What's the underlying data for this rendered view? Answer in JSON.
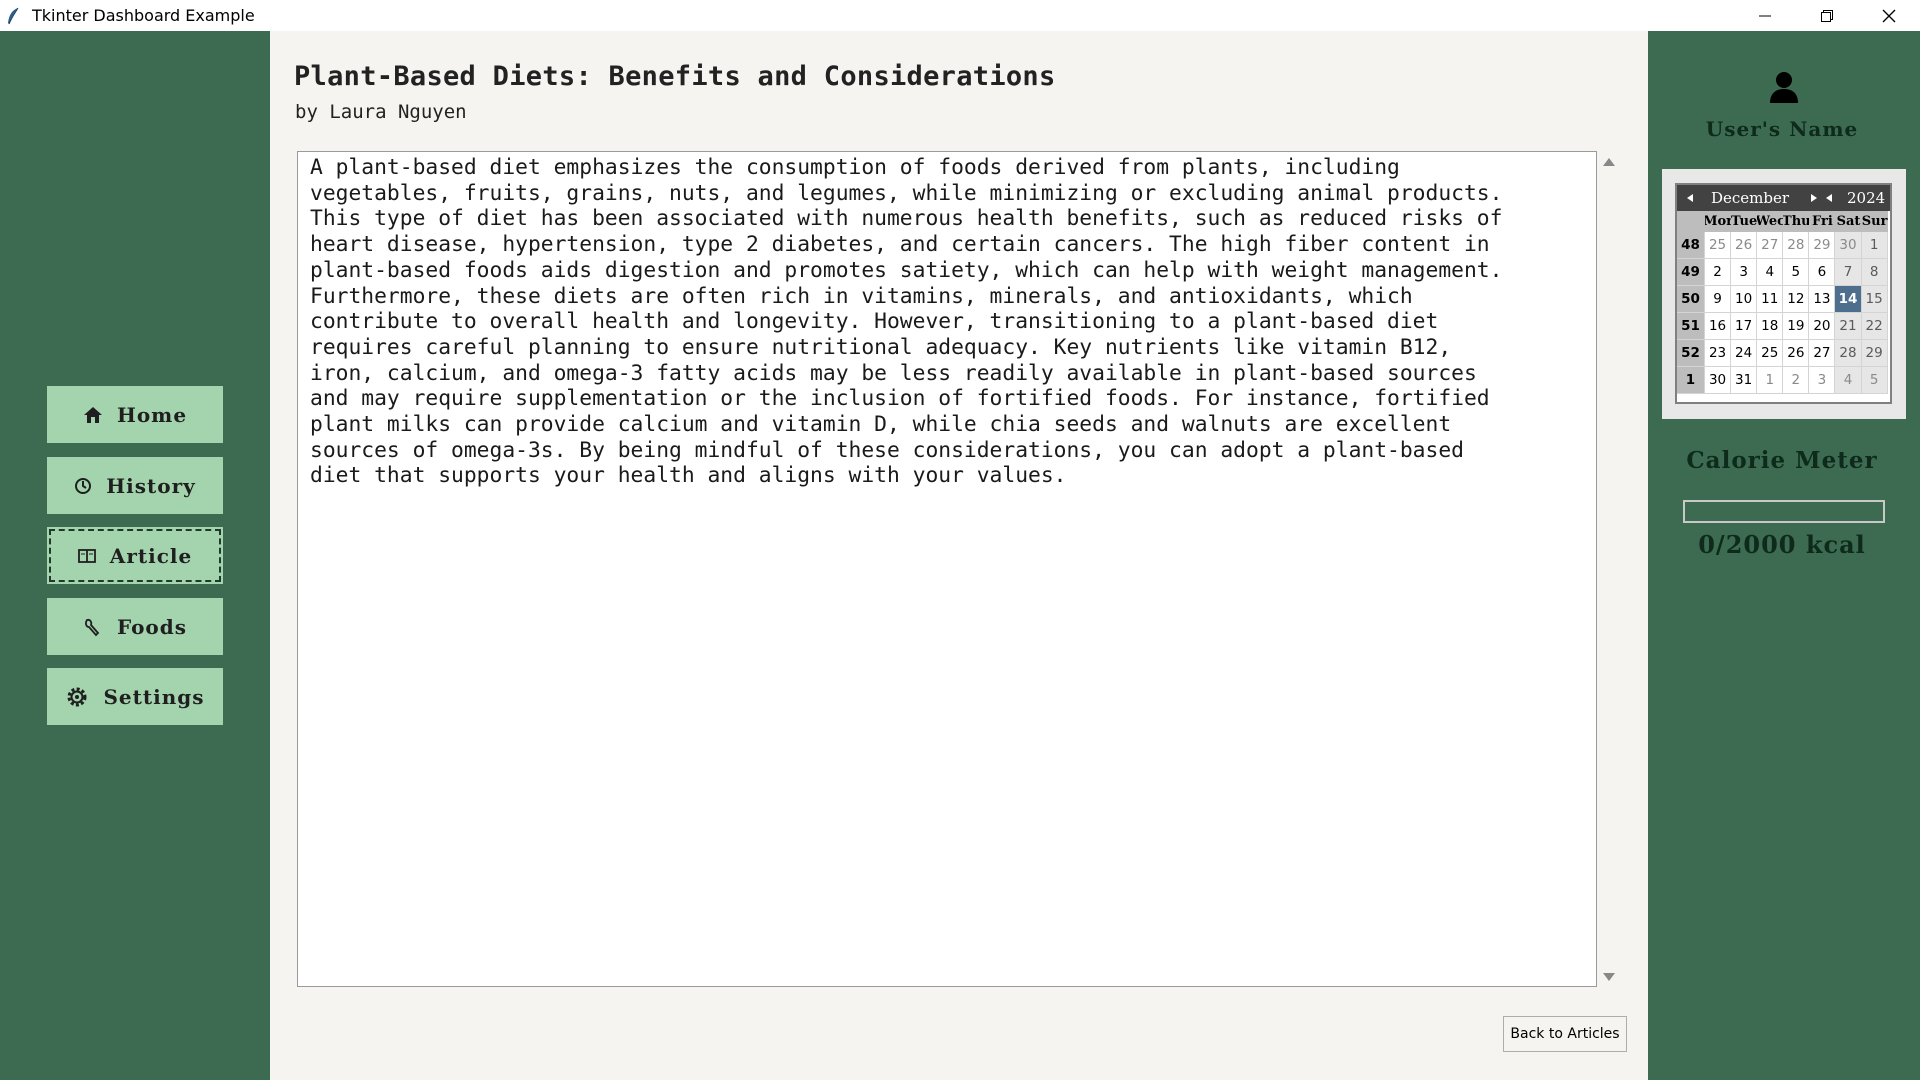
{
  "window": {
    "title": "Tkinter Dashboard Example"
  },
  "sidebar": {
    "items": [
      {
        "label": "Home",
        "icon": "house-icon"
      },
      {
        "label": "History",
        "icon": "clock-icon"
      },
      {
        "label": "Article",
        "icon": "book-icon",
        "active": true
      },
      {
        "label": "Foods",
        "icon": "food-icon"
      },
      {
        "label": "Settings",
        "icon": "gear-icon"
      }
    ]
  },
  "article": {
    "title": "Plant-Based Diets: Benefits and Considerations",
    "author": "by Laura Nguyen",
    "body": "A plant-based diet emphasizes the consumption of foods derived from plants, including\nvegetables, fruits, grains, nuts, and legumes, while minimizing or excluding animal products.\nThis type of diet has been associated with numerous health benefits, such as reduced risks of\nheart disease, hypertension, type 2 diabetes, and certain cancers. The high fiber content in\nplant-based foods aids digestion and promotes satiety, which can help with weight management.\nFurthermore, these diets are often rich in vitamins, minerals, and antioxidants, which\ncontribute to overall health and longevity. However, transitioning to a plant-based diet\nrequires careful planning to ensure nutritional adequacy. Key nutrients like vitamin B12,\niron, calcium, and omega-3 fatty acids may be less readily available in plant-based sources\nand may require supplementation or the inclusion of fortified foods. For instance, fortified\nplant milks can provide calcium and vitamin D, while chia seeds and walnuts are excellent\nsources of omega-3s. By being mindful of these considerations, you can adopt a plant-based\ndiet that supports your health and aligns with your values.",
    "back_label": "Back to Articles"
  },
  "user": {
    "name": "User's Name"
  },
  "calendar": {
    "month": "December",
    "year": "2024",
    "weekdays": [
      "Mor",
      "Tue",
      "Wec",
      "Thu",
      "Fri",
      "Sat",
      "Sur"
    ],
    "selected_day": "14",
    "weeks": [
      {
        "num": "48",
        "days": [
          "25",
          "26",
          "27",
          "28",
          "29",
          "30",
          "1"
        ],
        "other": [
          true,
          true,
          true,
          true,
          true,
          true,
          false
        ]
      },
      {
        "num": "49",
        "days": [
          "2",
          "3",
          "4",
          "5",
          "6",
          "7",
          "8"
        ],
        "other": [
          false,
          false,
          false,
          false,
          false,
          false,
          false
        ]
      },
      {
        "num": "50",
        "days": [
          "9",
          "10",
          "11",
          "12",
          "13",
          "14",
          "15"
        ],
        "other": [
          false,
          false,
          false,
          false,
          false,
          false,
          false
        ]
      },
      {
        "num": "51",
        "days": [
          "16",
          "17",
          "18",
          "19",
          "20",
          "21",
          "22"
        ],
        "other": [
          false,
          false,
          false,
          false,
          false,
          false,
          false
        ]
      },
      {
        "num": "52",
        "days": [
          "23",
          "24",
          "25",
          "26",
          "27",
          "28",
          "29"
        ],
        "other": [
          false,
          false,
          false,
          false,
          false,
          false,
          false
        ]
      },
      {
        "num": "1",
        "days": [
          "30",
          "31",
          "1",
          "2",
          "3",
          "4",
          "5"
        ],
        "other": [
          false,
          false,
          true,
          true,
          true,
          true,
          true
        ]
      }
    ]
  },
  "calorie_meter": {
    "title": "Calorie Meter",
    "value_text": "0/2000 kcal",
    "progress": 0
  },
  "colors": {
    "sidebar_bg": "#3d6b52",
    "button_bg": "#a4d4ae",
    "calendar_header": "#424242",
    "calendar_selected": "#4e6e8e"
  }
}
